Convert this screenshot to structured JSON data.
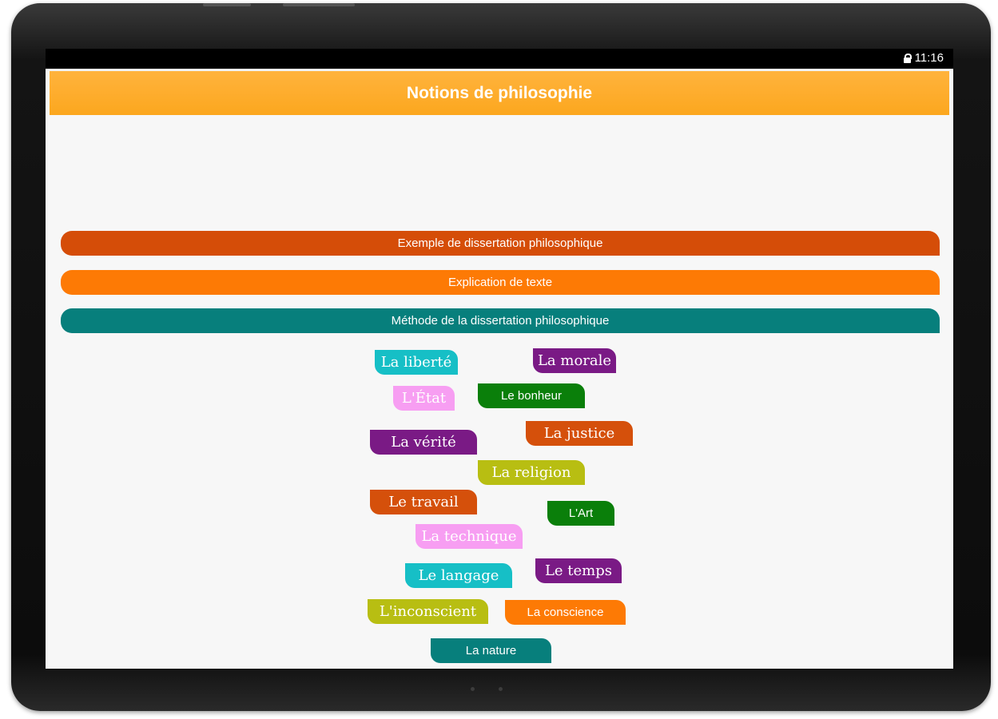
{
  "status_bar": {
    "time": "11:16",
    "lock_icon": "lock-icon"
  },
  "app_bar": {
    "title": "Notions de philosophie",
    "color": "#fca71e"
  },
  "menu_buttons": [
    {
      "label": "Exemple de dissertation philosophique",
      "color": "#d54d08"
    },
    {
      "label": "Explication de texte",
      "color": "#fd7a05"
    },
    {
      "label": "Méthode de la dissertation philosophique",
      "color": "#077f7c"
    }
  ],
  "notions": [
    {
      "label": "La liberté",
      "color": "#16bfc6"
    },
    {
      "label": "La morale",
      "color": "#7a1a85"
    },
    {
      "label": "L'État",
      "color": "#f79ef2"
    },
    {
      "label": "Le bonheur",
      "color": "#0a7f0a"
    },
    {
      "label": "La vérité",
      "color": "#7a1a85"
    },
    {
      "label": "La justice",
      "color": "#d5500b"
    },
    {
      "label": "La religion",
      "color": "#b8be12"
    },
    {
      "label": "Le travail",
      "color": "#d5500b"
    },
    {
      "label": "L'Art",
      "color": "#0a7f0a"
    },
    {
      "label": "La technique",
      "color": "#f79ef2"
    },
    {
      "label": "Le langage",
      "color": "#16bfc6"
    },
    {
      "label": "Le temps",
      "color": "#7a1a85"
    },
    {
      "label": "L'inconscient",
      "color": "#b8be12"
    },
    {
      "label": "La conscience",
      "color": "#fd7a05"
    },
    {
      "label": "La nature",
      "color": "#077f7c"
    }
  ]
}
